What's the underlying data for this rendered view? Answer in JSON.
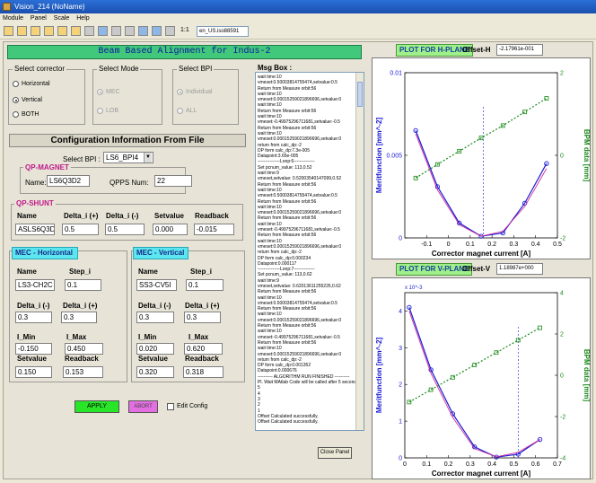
{
  "window": {
    "title": "Vision_214 (NoName)"
  },
  "menu": [
    "Module",
    "Panel",
    "Scale",
    "Help"
  ],
  "toolbar": {
    "zoom_text": "1:1",
    "language": "en_US.iso88591"
  },
  "banner": "Beam Based Alignment for Indus-2",
  "select_corrector": {
    "label": "Select corrector",
    "options": [
      "Horizontal",
      "Vertical",
      "BOTH"
    ],
    "selected": "Vertical"
  },
  "select_mode": {
    "label": "Select Mode",
    "options": [
      "MEC",
      "LOB"
    ],
    "selected": "MEC"
  },
  "select_bpi": {
    "label": "Select BPI",
    "options": [
      "Individual",
      "ALL"
    ],
    "selected": "Individual"
  },
  "config": {
    "title": "Configuration Information From File",
    "select_bpi_label": "Select BPI :",
    "select_bpi_value": "LS6_BPI4",
    "qp_magnet": {
      "label": "QP-MAGNET",
      "name_label": "Name:",
      "name_value": "LS6Q3D2",
      "qpps_label": "QPPS Num:",
      "qpps_value": "22"
    },
    "qp_shunt": {
      "label": "QP-SHUNT",
      "headers": [
        "Name",
        "Delta_i (+)",
        "Delta_i (-)",
        "Setvalue",
        "Readback"
      ],
      "values": [
        "ASLS6Q3D2",
        "0.5",
        "0.5",
        "0.000",
        "-0.015"
      ]
    },
    "mec_h": {
      "title": "MEC - Horizontal",
      "name_label": "Name",
      "name_value": "LS3-CH2C",
      "step_label": "Step_i",
      "step_value": "0.1",
      "dminus_label": "Delta_i (-)",
      "dminus_value": "0.3",
      "dplus_label": "Delta_i (+)",
      "dplus_value": "0.3",
      "imin_label": "I_Min",
      "imin_value": "-0.150",
      "imax_label": "I_Max",
      "imax_value": "0.450",
      "setvalue_label": "Setvalue",
      "setvalue_value": "0.150",
      "readback_label": "Readback",
      "readback_value": "0.153"
    },
    "mec_v": {
      "title": "MEC - Vertical",
      "name_label": "Name",
      "name_value": "SS3-CV5I",
      "step_label": "Step_i",
      "step_value": "0.1",
      "dminus_label": "Delta_i (-)",
      "dminus_value": "0.3",
      "dplus_label": "Delta_i (+)",
      "dplus_value": "0.3",
      "imin_label": "I_Min",
      "imin_value": "0.020",
      "imax_label": "I_Max",
      "imax_value": "0.620",
      "setvalue_label": "Setvalue",
      "setvalue_value": "0.320",
      "readback_label": "Readback",
      "readback_value": "0.318"
    }
  },
  "buttons": {
    "apply": "APPLY",
    "abort": "ABORT",
    "edit_config": "Edit Config",
    "close_panel": "Close Panel"
  },
  "colors": {
    "apply": "#28e528",
    "abort": "#e36fe3",
    "banner": "#42c87b",
    "plot_blue": "#1a1ad6",
    "plot_green": "#1a8a1a",
    "plot_pink": "#d12d9a"
  },
  "msgbox": {
    "label": "Msg Box :",
    "lines": [
      "wait time:10",
      "vmeset:0.50003814755474,setvalue:0.5",
      "Return from Measure orbit:56",
      "wait time:10",
      "vmeset:0.00015259021896696,setvalue:0",
      "wait time:10",
      "Return from Measure orbit:56",
      "wait time:10",
      "vmeset:-0.49975296711681,setvalue:-0.5",
      "Return from Measure orbit:56",
      "wait time:10",
      "vmeset:0.00015259021896696,setvalue:0",
      "return from calc_dp:-2",
      "DP form calc_dp:7.3e-005",
      "Datapoint:3.65e-005",
      "---------------Loop:6--------------",
      "Set pcnum_value: 113,0.52",
      "wait time:9",
      "vmeset,setvalue: 0.52003540147099,0.52",
      "Return from Measure orbit:56",
      "wait time:10",
      "vmeset:0.50003814755474,setvalue:0.5",
      "Return from Measure orbit:56",
      "wait time:10",
      "vmeset:0.00015259021896696,setvalue:0",
      "Return from Measure orbit:56",
      "wait time:10",
      "vmeset:-0.49975296711681,setvalue:-0.5",
      "Return from Measure orbit:56",
      "wait time:10",
      "vmeset:0.00015259021896696,setvalue:0",
      "return from calc_dp:-2",
      "DP form calc_dp:0.000234",
      "Datapoint:0.000117",
      "---------------Loop:7--------------",
      "Set pcnum_value: 113,0.62",
      "wait time:9",
      "vmeset,setvalue: 0.62013611255226,0.62",
      "Return from Measure orbit:56",
      "wait time:10",
      "vmeset:0.50003814755474,setvalue:0.5",
      "Return from Measure orbit:56",
      "wait time:10",
      "vmeset:0.00015259021896696,setvalue:0",
      "Return from Measure orbit:56",
      "wait time:10",
      "vmeset:-0.49975296711681,setvalue:-0.5",
      "Return from Measure orbit:56",
      "wait time:10",
      "vmeset:0.00015259021896696,setvalue:0",
      "return from calc_dp:-2",
      "DP form calc_dp:0.001352",
      "Datapoint:0.000676",
      "---------- ALGORITHM RUN FINISHED ----------",
      "Pl. Wait MAtlab Code will be called after 5 seconds.",
      "5",
      "4",
      "3",
      "2",
      "1",
      "Offset Calculated successfully.",
      "Offset Calculated successfully."
    ]
  },
  "plot_h": {
    "title": "PLOT FOR H-PLANE",
    "offset_label": "Offset-H",
    "offset_value": "-2.17961e-001"
  },
  "plot_v": {
    "title": "PLOT FOR V-PLANE",
    "offset_label": "Offset-V",
    "offset_value": "1.18987e+000"
  },
  "chart_data": [
    {
      "type": "line",
      "xlabel": "Corrector magnet current [A]",
      "ylabel": "Meritfunction [mm^-2]",
      "y2label": "BPM data [mm]",
      "xlim": [
        -0.2,
        0.5
      ],
      "ylim": [
        0,
        0.01
      ],
      "y2lim": [
        -2,
        2
      ],
      "xticks": [
        -0.1,
        0,
        0.1,
        0.2,
        0.3,
        0.4,
        0.5
      ],
      "yticks": [
        0,
        0.005,
        0.01
      ],
      "y2ticks": [
        -2,
        0,
        2
      ],
      "vline": 0.16,
      "series": [
        {
          "axis": "left",
          "color": "#1a1ad6",
          "x": [
            -0.15,
            -0.05,
            0.05,
            0.15,
            0.25,
            0.35,
            0.45
          ],
          "values": [
            0.0065,
            0.0031,
            0.0009,
            0.0001,
            0.0003,
            0.0021,
            0.0045
          ]
        },
        {
          "axis": "left",
          "color": "#d12d9a",
          "x": [
            -0.15,
            -0.05,
            0.05,
            0.15,
            0.25,
            0.35,
            0.45
          ],
          "values": [
            0.0063,
            0.0029,
            0.0008,
            0.0001,
            0.0004,
            0.0019,
            0.0042
          ]
        },
        {
          "axis": "right",
          "color": "#1a8a1a",
          "x": [
            -0.15,
            -0.05,
            0.05,
            0.15,
            0.25,
            0.35,
            0.45
          ],
          "values": [
            -0.55,
            -0.22,
            0.1,
            0.42,
            0.72,
            1.05,
            1.38
          ]
        }
      ]
    },
    {
      "type": "line",
      "xlabel": "Corrector magnet current [A]",
      "ylabel": "Meritfunction [mm^-2]",
      "y2label": "BPM data [mm]",
      "xlim": [
        0,
        0.7
      ],
      "ylim": [
        0,
        0.0045
      ],
      "y2lim": [
        -4,
        4
      ],
      "yexponent": "x 10^-3",
      "xticks": [
        0,
        0.1,
        0.2,
        0.3,
        0.4,
        0.5,
        0.6,
        0.7
      ],
      "yticks": [
        0,
        1,
        2,
        3,
        4
      ],
      "y2ticks": [
        -4,
        -2,
        0,
        2,
        4
      ],
      "vline": 0.52,
      "series": [
        {
          "axis": "left",
          "color": "#1a1ad6",
          "x": [
            0.02,
            0.12,
            0.22,
            0.32,
            0.42,
            0.52,
            0.62
          ],
          "values": [
            0.0041,
            0.0024,
            0.0012,
            0.0003,
            2e-05,
            0.0001,
            0.0005
          ]
        },
        {
          "axis": "left",
          "color": "#d12d9a",
          "x": [
            0.02,
            0.12,
            0.22,
            0.32,
            0.42,
            0.52,
            0.62
          ],
          "values": [
            0.004,
            0.0023,
            0.0011,
            0.00025,
            3e-05,
            0.00015,
            0.0005
          ]
        },
        {
          "axis": "right",
          "color": "#1a8a1a",
          "x": [
            0.02,
            0.12,
            0.22,
            0.32,
            0.42,
            0.52,
            0.62
          ],
          "values": [
            -1.3,
            -0.7,
            -0.1,
            0.5,
            1.1,
            1.7,
            2.3
          ]
        }
      ]
    }
  ]
}
